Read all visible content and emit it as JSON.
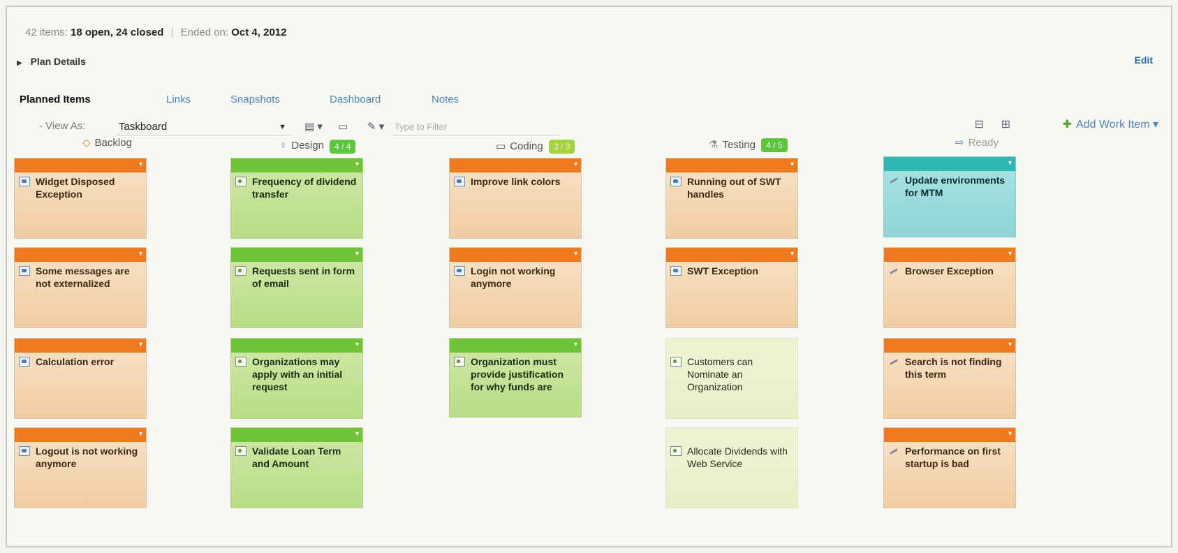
{
  "summary": {
    "items_label": "42 items:",
    "counts": "18 open, 24 closed",
    "ended_label": "Ended on:",
    "ended_date": "Oct 4, 2012"
  },
  "plan_details": {
    "label": "Plan Details",
    "edit": "Edit"
  },
  "tabs": [
    {
      "label": "Planned Items",
      "active": true
    },
    {
      "label": "Links"
    },
    {
      "label": "Snapshots"
    },
    {
      "label": "Dashboard"
    },
    {
      "label": "Notes"
    }
  ],
  "toolbar": {
    "view_as_label": "View As:",
    "view_as_value": "Taskboard",
    "filter_placeholder": "Type to Filter",
    "add_work_item": "Add Work Item"
  },
  "columns": [
    {
      "name": "Backlog",
      "badge": ""
    },
    {
      "name": "Design",
      "badge": "4 / 4"
    },
    {
      "name": "Coding",
      "badge": "3 / 3"
    },
    {
      "name": "Testing",
      "badge": "4 / 5"
    },
    {
      "name": "Ready",
      "badge": ""
    }
  ],
  "cards": {
    "backlog": [
      {
        "title": "Widget Disposed Exception",
        "color": "orange",
        "icon": "defect-icon"
      },
      {
        "title": "Some messages are not externalized",
        "color": "orange",
        "icon": "defect-icon"
      },
      {
        "title": "Calculation error",
        "color": "orange",
        "icon": "defect-icon"
      },
      {
        "title": "Logout is not working anymore",
        "color": "orange",
        "icon": "defect-icon"
      }
    ],
    "design": [
      {
        "title": "Frequency of dividend transfer",
        "color": "green",
        "icon": "task-icon"
      },
      {
        "title": "Requests sent in form of email",
        "color": "green",
        "icon": "task-icon"
      },
      {
        "title": "Organizations may apply with an initial request",
        "color": "green",
        "icon": "task-icon"
      },
      {
        "title": "Validate Loan Term and Amount",
        "color": "green",
        "icon": "task-icon"
      }
    ],
    "coding": [
      {
        "title": "Improve link colors",
        "color": "orange",
        "icon": "defect-icon"
      },
      {
        "title": "Login not working anymore",
        "color": "orange",
        "icon": "defect-icon"
      },
      {
        "title": "Organization must provide justification for why funds are",
        "color": "green",
        "icon": "task-icon"
      }
    ],
    "testing": [
      {
        "title": "Running out of SWT handles",
        "color": "orange",
        "icon": "defect-icon"
      },
      {
        "title": "SWT Exception",
        "color": "orange",
        "icon": "defect-icon"
      },
      {
        "title": "Customers can Nominate an Organization",
        "color": "pale",
        "icon": "task-icon"
      },
      {
        "title": "Allocate Dividends with Web Service",
        "color": "pale",
        "icon": "task-icon"
      }
    ],
    "ready": [
      {
        "title": "Update environments for MTM",
        "color": "teal",
        "icon": "pencil-icon"
      },
      {
        "title": "Browser Exception",
        "color": "orange",
        "icon": "pencil-icon"
      },
      {
        "title": "Search is not finding this term",
        "color": "orange",
        "icon": "pencil-icon"
      },
      {
        "title": "Performance on first startup is bad",
        "color": "orange",
        "icon": "pencil-icon"
      }
    ]
  },
  "colors": {
    "orange_bar": "#ef7a1e",
    "green_bar": "#6fc43a",
    "teal_bar": "#2fb8b4",
    "link": "#4f86b8"
  }
}
